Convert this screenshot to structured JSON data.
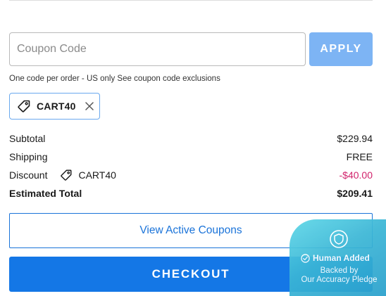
{
  "coupon": {
    "placeholder": "Coupon Code",
    "value": "",
    "apply_label": "APPLY",
    "note": "One code per order - US only See coupon code exclusions"
  },
  "applied_coupon": {
    "code": "CART40",
    "tag_icon": "tag-icon",
    "remove_icon": "close-icon"
  },
  "summary": {
    "subtotal_label": "Subtotal",
    "subtotal_value": "$229.94",
    "shipping_label": "Shipping",
    "shipping_value": "FREE",
    "discount_label": "Discount",
    "discount_code": "CART40",
    "discount_value": "-$40.00",
    "total_label": "Estimated Total",
    "total_value": "$209.41"
  },
  "actions": {
    "view_coupons_label": "View Active Coupons",
    "checkout_label": "CHECKOUT"
  },
  "badge": {
    "title": "Human Added",
    "line2": "Backed by",
    "line3": "Our Accuracy Pledge",
    "icon": "shield-icon"
  },
  "colors": {
    "accent": "#1477e6",
    "apply_disabled": "#7db4f4",
    "discount": "#d1226b",
    "badge_gradient_start": "#5fd8e8",
    "badge_gradient_end": "#2aa0cc"
  }
}
